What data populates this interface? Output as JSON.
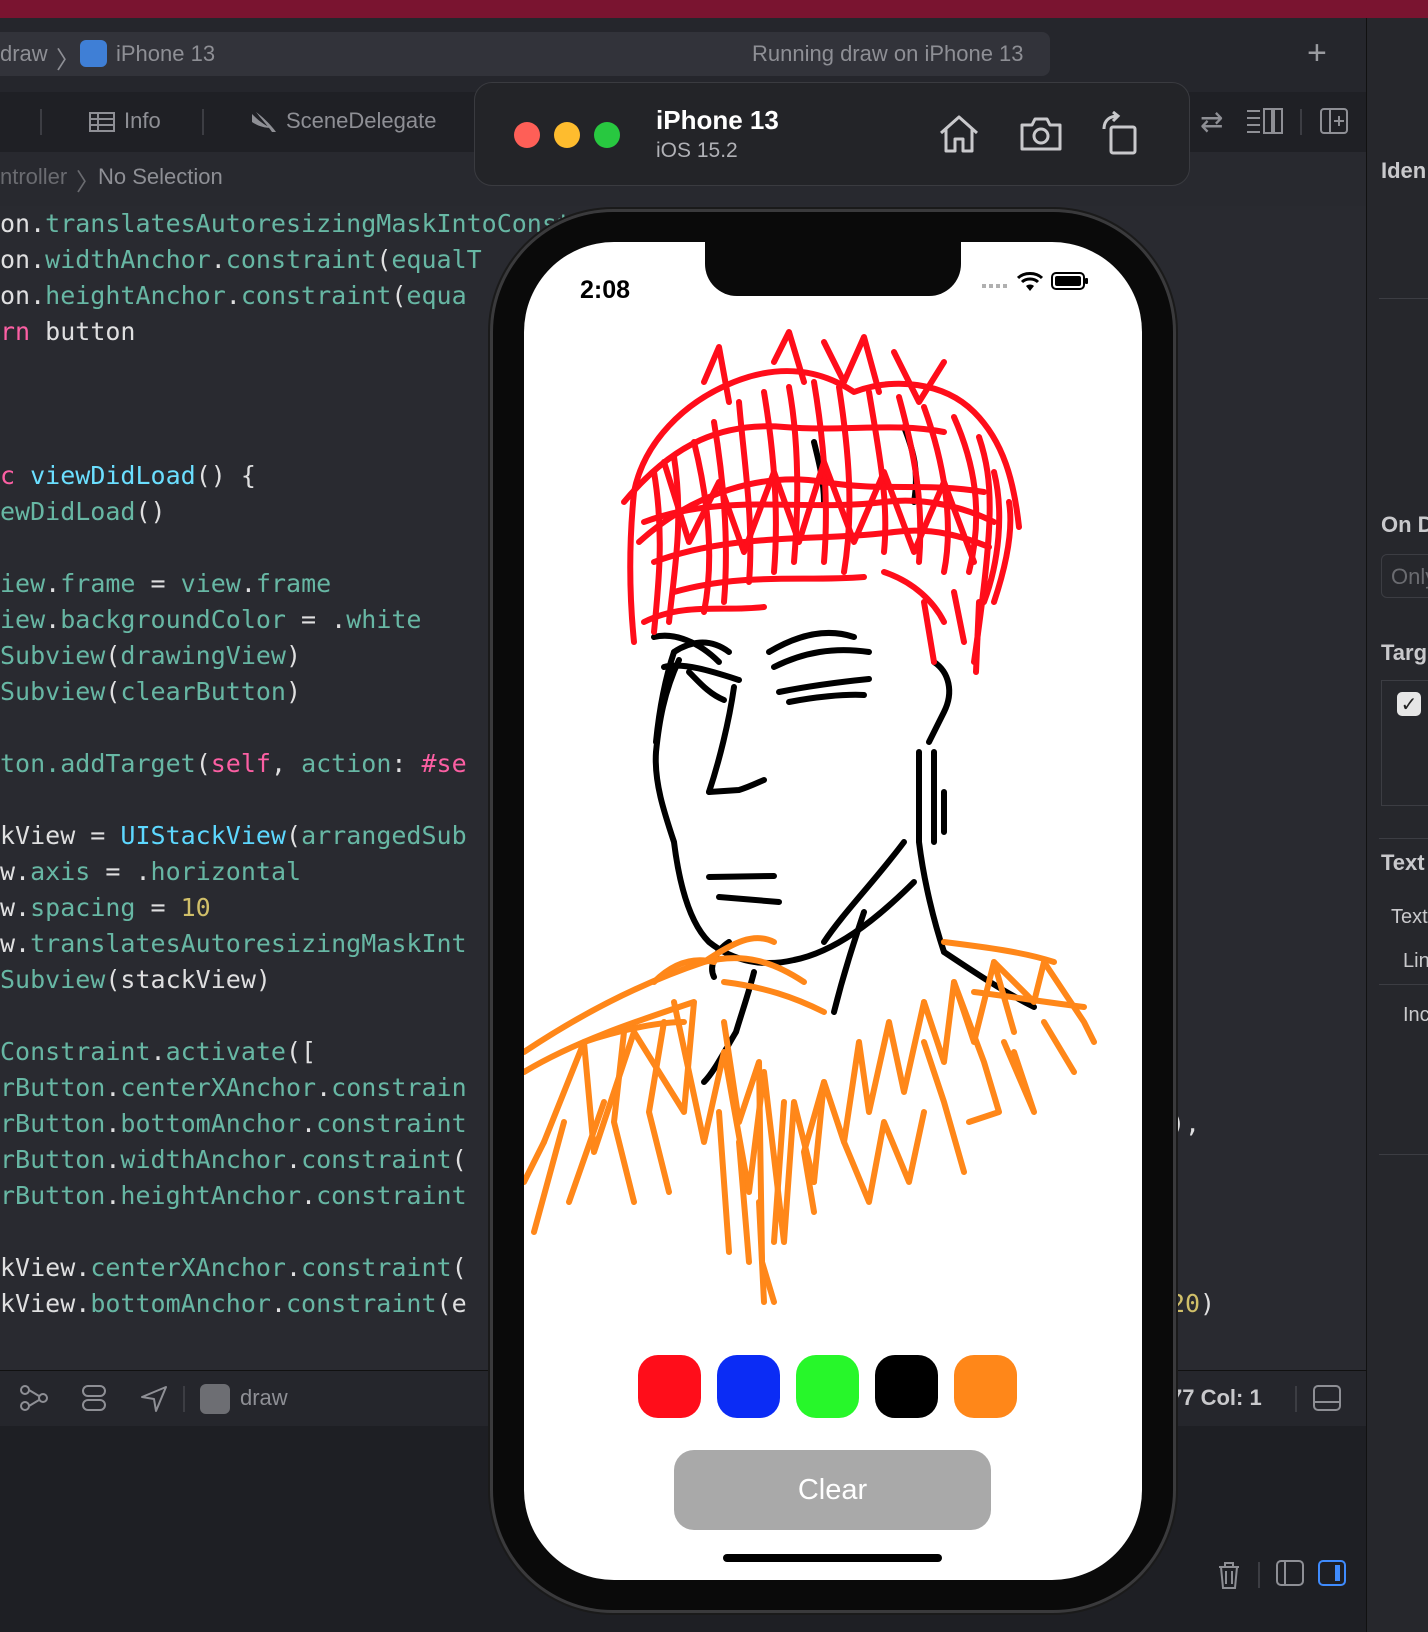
{
  "toolbar": {
    "scheme": "draw",
    "device": "iPhone 13",
    "status": "Running draw on iPhone 13"
  },
  "tabs": {
    "info": "Info",
    "scene_delegate": "SceneDelegate"
  },
  "jumpbar": {
    "controller": "ntroller",
    "selection": "No Selection"
  },
  "code_lines": [
    [
      [
        "on.",
        "d"
      ],
      [
        "translatesAutoresizingMaskIntoConstraints = false",
        "p"
      ]
    ],
    [
      [
        "on.",
        "d"
      ],
      [
        "widthAnchor",
        "p"
      ],
      [
        ".",
        "d"
      ],
      [
        "constraint",
        "p"
      ],
      [
        "(",
        "d"
      ],
      [
        "equalT",
        "p"
      ]
    ],
    [
      [
        "on.",
        "d"
      ],
      [
        "heightAnchor",
        "p"
      ],
      [
        ".",
        "d"
      ],
      [
        "constraint",
        "p"
      ],
      [
        "(",
        "d"
      ],
      [
        "equa",
        "p"
      ]
    ],
    [
      [
        "rn",
        "k"
      ],
      [
        " button",
        "d"
      ]
    ],
    [],
    [],
    [],
    [
      [
        "c ",
        "k"
      ],
      [
        "viewDidLoad",
        "f"
      ],
      [
        "() {",
        "d"
      ]
    ],
    [
      [
        "ewDidLoad",
        "p"
      ],
      [
        "()",
        "d"
      ]
    ],
    [],
    [
      [
        "iew",
        "p"
      ],
      [
        ".",
        "d"
      ],
      [
        "frame",
        "p"
      ],
      [
        " = ",
        "d"
      ],
      [
        "view",
        "p"
      ],
      [
        ".",
        "d"
      ],
      [
        "frame",
        "p"
      ]
    ],
    [
      [
        "iew",
        "p"
      ],
      [
        ".",
        "d"
      ],
      [
        "backgroundColor",
        "p"
      ],
      [
        " = .",
        "d"
      ],
      [
        "white",
        "p"
      ]
    ],
    [
      [
        "Subview",
        "p"
      ],
      [
        "(",
        "d"
      ],
      [
        "drawingView",
        "p"
      ],
      [
        ")",
        "d"
      ]
    ],
    [
      [
        "Subview",
        "p"
      ],
      [
        "(",
        "d"
      ],
      [
        "clearButton",
        "p"
      ],
      [
        ")",
        "d"
      ]
    ],
    [],
    [
      [
        "ton.",
        "p"
      ],
      [
        "addTarget",
        "p"
      ],
      [
        "(",
        "d"
      ],
      [
        "self",
        "k"
      ],
      [
        ", ",
        "d"
      ],
      [
        "action",
        "p"
      ],
      [
        ": ",
        "d"
      ],
      [
        "#se",
        "k"
      ]
    ],
    [],
    [
      [
        "kView = ",
        "d"
      ],
      [
        "UIStackView",
        "t"
      ],
      [
        "(",
        "d"
      ],
      [
        "arrangedSub",
        "p"
      ]
    ],
    [
      [
        "w.",
        "d"
      ],
      [
        "axis",
        "p"
      ],
      [
        " = .",
        "d"
      ],
      [
        "horizontal",
        "p"
      ]
    ],
    [
      [
        "w.",
        "d"
      ],
      [
        "spacing",
        "p"
      ],
      [
        " = ",
        "d"
      ],
      [
        "10",
        "n"
      ]
    ],
    [
      [
        "w.",
        "d"
      ],
      [
        "translatesAutoresizingMaskInt",
        "p"
      ]
    ],
    [
      [
        "Subview",
        "p"
      ],
      [
        "(stackView)",
        "d"
      ]
    ],
    [],
    [
      [
        "Constraint",
        "p"
      ],
      [
        ".",
        "d"
      ],
      [
        "activate",
        "p"
      ],
      [
        "([",
        "d"
      ]
    ],
    [
      [
        "rButton",
        "p"
      ],
      [
        ".",
        "d"
      ],
      [
        "centerXAnchor",
        "p"
      ],
      [
        ".",
        "d"
      ],
      [
        "constrain",
        "p"
      ]
    ],
    [
      [
        "rButton",
        "p"
      ],
      [
        ".",
        "d"
      ],
      [
        "bottomAnchor",
        "p"
      ],
      [
        ".",
        "d"
      ],
      [
        "constraint",
        "p"
      ]
    ],
    [
      [
        "rButton",
        "p"
      ],
      [
        ".",
        "d"
      ],
      [
        "widthAnchor",
        "p"
      ],
      [
        ".",
        "d"
      ],
      [
        "constraint",
        "p"
      ],
      [
        "(",
        "d"
      ]
    ],
    [
      [
        "rButton",
        "p"
      ],
      [
        ".",
        "d"
      ],
      [
        "heightAnchor",
        "p"
      ],
      [
        ".",
        "d"
      ],
      [
        "constraint",
        "p"
      ]
    ],
    [],
    [
      [
        "kView.",
        "d"
      ],
      [
        "centerXAnchor",
        "p"
      ],
      [
        ".",
        "d"
      ],
      [
        "constraint",
        "p"
      ],
      [
        "(",
        "d"
      ]
    ],
    [
      [
        "kView.",
        "d"
      ],
      [
        "bottomAnchor",
        "p"
      ],
      [
        ".",
        "d"
      ],
      [
        "constraint",
        "p"
      ],
      [
        "(e",
        "d"
      ]
    ]
  ],
  "right_code_fragments": {
    "line1": "),",
    "line2_num": "20",
    "line2_tail": ")"
  },
  "debugbar": {
    "target": "draw",
    "position": "77  Col: 1"
  },
  "inspector": {
    "identity": "Iden",
    "on_demand": "On D",
    "only": "Only",
    "target": "Targ",
    "text": "Text",
    "text_row": "Text",
    "line_row": "Lin",
    "indent_row": "Inc"
  },
  "simulator": {
    "device_name": "iPhone 13",
    "os_version": "iOS 15.2",
    "status_time": "2:08",
    "swatches": [
      {
        "name": "red",
        "color": "#ff0d1a"
      },
      {
        "name": "blue",
        "color": "#0b2cf5"
      },
      {
        "name": "green",
        "color": "#27f72a"
      },
      {
        "name": "black",
        "color": "#000000"
      },
      {
        "name": "orange",
        "color": "#ff8719"
      }
    ],
    "clear_label": "Clear"
  }
}
